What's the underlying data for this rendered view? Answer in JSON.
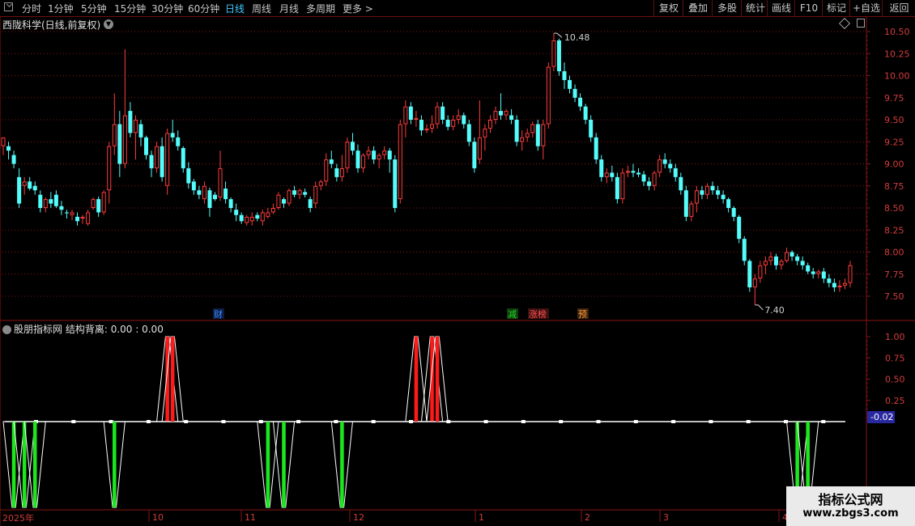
{
  "toolbar": {
    "periods": [
      "分时",
      "1分钟",
      "5分钟",
      "15分钟",
      "30分钟",
      "60分钟",
      "日线",
      "周线",
      "月线",
      "多周期",
      "更多 >"
    ],
    "active_period": "日线",
    "right_buttons": [
      "复权",
      "叠加",
      "多股",
      "统计",
      "画线",
      "F10",
      "标记",
      "+自选",
      "返回"
    ]
  },
  "main_chart": {
    "title": "西陇科学(日线,前复权)",
    "y_ticks": [
      "10.50",
      "10.25",
      "10.00",
      "9.75",
      "9.50",
      "9.25",
      "9.00",
      "8.75",
      "8.50",
      "8.25",
      "8.00",
      "7.75",
      "7.50"
    ],
    "high_label": "10.48",
    "low_label": "7.40",
    "event_markers": [
      {
        "text": "财",
        "color": "#3c8cff"
      },
      {
        "text": "减",
        "color": "#22d622"
      },
      {
        "text": "涨榜",
        "color": "#ff5050"
      },
      {
        "text": "预",
        "color": "#ff9a30"
      }
    ],
    "colors": {
      "up": "#ff3c3c",
      "down": "#54fcfc",
      "grid": "#8a1414"
    }
  },
  "indicator": {
    "site": "股朋指标网",
    "name": "结构背离",
    "values": "0.00 : 0.00",
    "y_ticks": [
      "1.00",
      "0.75",
      "0.50",
      "0.25"
    ],
    "current_value": "-0.02",
    "colors": {
      "positive": "#ff1a1a",
      "negative": "#1ee61e",
      "baseline": "#ffffff"
    }
  },
  "time_axis": {
    "year_label": "2025年",
    "labels": [
      "10",
      "11",
      "12",
      "1",
      "2",
      "3",
      "4"
    ]
  },
  "watermark": {
    "line1": "指标公式网",
    "line2": "www.zbgs3.com"
  },
  "chart_data": {
    "type": "candlestick",
    "title": "西陇科学(日线,前复权)",
    "ylim": [
      7.35,
      10.6
    ],
    "candles": [
      [
        9.2,
        9.3,
        9.1,
        9.3
      ],
      [
        9.2,
        9.25,
        9.05,
        9.15
      ],
      [
        9.1,
        9.15,
        8.95,
        9.0
      ],
      [
        8.85,
        8.95,
        8.5,
        8.55
      ],
      [
        8.75,
        8.85,
        8.65,
        8.8
      ],
      [
        8.8,
        8.85,
        8.7,
        8.72
      ],
      [
        8.75,
        8.8,
        8.65,
        8.7
      ],
      [
        8.65,
        8.7,
        8.45,
        8.5
      ],
      [
        8.5,
        8.62,
        8.45,
        8.6
      ],
      [
        8.6,
        8.68,
        8.5,
        8.55
      ],
      [
        8.65,
        8.7,
        8.5,
        8.52
      ],
      [
        8.52,
        8.58,
        8.42,
        8.48
      ],
      [
        8.45,
        8.48,
        8.38,
        8.44
      ],
      [
        8.42,
        8.48,
        8.36,
        8.45
      ],
      [
        8.4,
        8.45,
        8.3,
        8.35
      ],
      [
        8.38,
        8.42,
        8.32,
        8.4
      ],
      [
        8.32,
        8.48,
        8.3,
        8.45
      ],
      [
        8.5,
        8.62,
        8.48,
        8.6
      ],
      [
        8.6,
        8.63,
        8.4,
        8.45
      ],
      [
        8.45,
        8.7,
        8.42,
        8.68
      ],
      [
        8.7,
        9.25,
        8.55,
        9.2
      ],
      [
        9.2,
        9.8,
        9.1,
        9.45
      ],
      [
        9.45,
        9.6,
        8.85,
        9.0
      ],
      [
        9.0,
        10.3,
        8.95,
        9.55
      ],
      [
        9.6,
        9.7,
        9.3,
        9.35
      ],
      [
        9.35,
        9.55,
        9.05,
        9.5
      ],
      [
        9.45,
        9.5,
        9.2,
        9.3
      ],
      [
        9.3,
        9.32,
        9.05,
        9.1
      ],
      [
        9.1,
        9.15,
        8.85,
        8.95
      ],
      [
        8.95,
        9.25,
        8.9,
        9.2
      ],
      [
        9.2,
        9.3,
        8.8,
        8.85
      ],
      [
        8.75,
        9.4,
        8.65,
        9.35
      ],
      [
        9.35,
        9.5,
        9.25,
        9.3
      ],
      [
        9.3,
        9.38,
        9.15,
        9.2
      ],
      [
        9.18,
        9.2,
        8.9,
        8.95
      ],
      [
        8.95,
        9.02,
        8.72,
        8.78
      ],
      [
        8.8,
        8.83,
        8.65,
        8.7
      ],
      [
        8.7,
        8.75,
        8.6,
        8.65
      ],
      [
        8.6,
        8.8,
        8.55,
        8.75
      ],
      [
        8.7,
        8.73,
        8.4,
        8.5
      ],
      [
        8.65,
        8.68,
        8.58,
        8.6
      ],
      [
        8.62,
        9.15,
        8.58,
        8.95
      ],
      [
        8.72,
        8.8,
        8.55,
        8.6
      ],
      [
        8.6,
        8.62,
        8.45,
        8.5
      ],
      [
        8.48,
        8.55,
        8.35,
        8.42
      ],
      [
        8.42,
        8.45,
        8.32,
        8.35
      ],
      [
        8.33,
        8.42,
        8.3,
        8.4
      ],
      [
        8.35,
        8.45,
        8.3,
        8.4
      ],
      [
        8.42,
        8.45,
        8.35,
        8.38
      ],
      [
        8.35,
        8.48,
        8.3,
        8.45
      ],
      [
        8.4,
        8.5,
        8.38,
        8.45
      ],
      [
        8.45,
        8.55,
        8.43,
        8.5
      ],
      [
        8.5,
        8.68,
        8.48,
        8.65
      ],
      [
        8.6,
        8.62,
        8.5,
        8.55
      ],
      [
        8.55,
        8.72,
        8.52,
        8.7
      ],
      [
        8.7,
        8.75,
        8.62,
        8.65
      ],
      [
        8.65,
        8.72,
        8.6,
        8.7
      ],
      [
        8.68,
        8.72,
        8.62,
        8.65
      ],
      [
        8.6,
        8.63,
        8.45,
        8.5
      ],
      [
        8.55,
        8.8,
        8.5,
        8.75
      ],
      [
        8.75,
        8.82,
        8.7,
        8.8
      ],
      [
        8.8,
        9.12,
        8.75,
        9.05
      ],
      [
        9.05,
        9.15,
        8.95,
        9.0
      ],
      [
        8.95,
        9.0,
        8.8,
        8.85
      ],
      [
        8.85,
        9.1,
        8.8,
        8.95
      ],
      [
        8.95,
        9.3,
        8.9,
        9.25
      ],
      [
        9.25,
        9.35,
        9.1,
        9.15
      ],
      [
        9.15,
        9.22,
        8.9,
        8.95
      ],
      [
        8.95,
        9.12,
        8.9,
        9.1
      ],
      [
        9.1,
        9.2,
        9.05,
        9.15
      ],
      [
        9.15,
        9.2,
        9.0,
        9.05
      ],
      [
        9.05,
        9.12,
        8.95,
        9.1
      ],
      [
        9.1,
        9.2,
        9.05,
        9.15
      ],
      [
        9.15,
        9.18,
        8.9,
        9.05
      ],
      [
        9.05,
        9.1,
        8.45,
        8.5
      ],
      [
        8.6,
        9.5,
        8.55,
        9.45
      ],
      [
        9.45,
        9.72,
        9.3,
        9.65
      ],
      [
        9.65,
        9.7,
        9.45,
        9.5
      ],
      [
        9.5,
        9.6,
        9.42,
        9.52
      ],
      [
        9.5,
        9.55,
        9.32,
        9.38
      ],
      [
        9.38,
        9.45,
        9.35,
        9.4
      ],
      [
        9.4,
        9.55,
        9.35,
        9.45
      ],
      [
        9.45,
        9.7,
        9.4,
        9.65
      ],
      [
        9.65,
        9.7,
        9.45,
        9.5
      ],
      [
        9.5,
        9.55,
        9.38,
        9.42
      ],
      [
        9.42,
        9.55,
        9.38,
        9.5
      ],
      [
        9.5,
        9.62,
        9.45,
        9.55
      ],
      [
        9.55,
        9.58,
        9.4,
        9.45
      ],
      [
        9.45,
        9.5,
        9.2,
        9.25
      ],
      [
        9.25,
        9.3,
        8.9,
        8.95
      ],
      [
        9.05,
        9.72,
        9.0,
        9.3
      ],
      [
        9.3,
        9.45,
        9.15,
        9.4
      ],
      [
        9.4,
        9.55,
        9.35,
        9.5
      ],
      [
        9.5,
        9.65,
        9.45,
        9.6
      ],
      [
        9.6,
        9.8,
        9.5,
        9.55
      ],
      [
        9.55,
        9.62,
        9.5,
        9.6
      ],
      [
        9.55,
        9.62,
        9.45,
        9.5
      ],
      [
        9.5,
        9.55,
        9.2,
        9.25
      ],
      [
        9.25,
        9.38,
        9.15,
        9.3
      ],
      [
        9.3,
        9.4,
        9.25,
        9.35
      ],
      [
        9.35,
        9.48,
        9.3,
        9.45
      ],
      [
        9.45,
        9.5,
        9.15,
        9.2
      ],
      [
        9.2,
        9.5,
        9.05,
        9.45
      ],
      [
        9.45,
        10.15,
        9.4,
        10.1
      ],
      [
        10.1,
        10.48,
        10.05,
        10.4
      ],
      [
        10.4,
        10.42,
        10.0,
        10.05
      ],
      [
        10.05,
        10.15,
        9.85,
        9.95
      ],
      [
        9.95,
        10.0,
        9.8,
        9.85
      ],
      [
        9.85,
        9.9,
        9.7,
        9.75
      ],
      [
        9.75,
        9.8,
        9.6,
        9.65
      ],
      [
        9.65,
        9.68,
        9.45,
        9.5
      ],
      [
        9.5,
        9.55,
        9.25,
        9.3
      ],
      [
        9.3,
        9.35,
        9.0,
        9.05
      ],
      [
        9.05,
        9.1,
        8.8,
        8.85
      ],
      [
        8.85,
        8.95,
        8.78,
        8.9
      ],
      [
        8.9,
        8.98,
        8.8,
        8.85
      ],
      [
        8.85,
        8.9,
        8.55,
        8.6
      ],
      [
        8.6,
        8.95,
        8.55,
        8.9
      ],
      [
        8.9,
        8.98,
        8.85,
        8.92
      ],
      [
        8.92,
        9.0,
        8.85,
        8.9
      ],
      [
        8.9,
        8.95,
        8.85,
        8.88
      ],
      [
        8.88,
        8.92,
        8.75,
        8.8
      ],
      [
        8.8,
        8.85,
        8.7,
        8.75
      ],
      [
        8.75,
        8.92,
        8.7,
        8.9
      ],
      [
        8.9,
        9.1,
        8.85,
        9.05
      ],
      [
        9.05,
        9.12,
        8.95,
        9.0
      ],
      [
        9.0,
        9.05,
        8.9,
        8.95
      ],
      [
        8.95,
        9.0,
        8.8,
        8.85
      ],
      [
        8.85,
        8.9,
        8.65,
        8.7
      ],
      [
        8.7,
        8.75,
        8.35,
        8.4
      ],
      [
        8.4,
        8.58,
        8.35,
        8.55
      ],
      [
        8.55,
        8.75,
        8.45,
        8.7
      ],
      [
        8.7,
        8.75,
        8.6,
        8.65
      ],
      [
        8.65,
        8.78,
        8.6,
        8.75
      ],
      [
        8.75,
        8.8,
        8.65,
        8.7
      ],
      [
        8.7,
        8.75,
        8.6,
        8.65
      ],
      [
        8.65,
        8.7,
        8.55,
        8.6
      ],
      [
        8.6,
        8.62,
        8.45,
        8.5
      ],
      [
        8.5,
        8.52,
        8.35,
        8.4
      ],
      [
        8.4,
        8.42,
        8.1,
        8.15
      ],
      [
        8.15,
        8.18,
        7.85,
        7.9
      ],
      [
        7.9,
        7.92,
        7.55,
        7.6
      ],
      [
        7.6,
        7.75,
        7.4,
        7.7
      ],
      [
        7.7,
        7.9,
        7.65,
        7.85
      ],
      [
        7.85,
        7.95,
        7.75,
        7.9
      ],
      [
        7.9,
        8.0,
        7.85,
        7.95
      ],
      [
        7.95,
        7.98,
        7.8,
        7.85
      ],
      [
        7.85,
        7.92,
        7.8,
        7.9
      ],
      [
        7.9,
        8.05,
        7.88,
        8.0
      ],
      [
        8.0,
        8.02,
        7.9,
        7.95
      ],
      [
        7.95,
        7.98,
        7.85,
        7.9
      ],
      [
        7.9,
        7.95,
        7.8,
        7.85
      ],
      [
        7.85,
        7.88,
        7.75,
        7.78
      ],
      [
        7.78,
        7.82,
        7.7,
        7.75
      ],
      [
        7.75,
        7.8,
        7.7,
        7.78
      ],
      [
        7.78,
        7.82,
        7.65,
        7.7
      ],
      [
        7.7,
        7.75,
        7.6,
        7.65
      ],
      [
        7.65,
        7.7,
        7.55,
        7.6
      ],
      [
        7.6,
        7.68,
        7.55,
        7.62
      ],
      [
        7.62,
        7.7,
        7.58,
        7.65
      ],
      [
        7.65,
        7.9,
        7.6,
        7.85
      ]
    ],
    "indicator_series": {
      "name": "结构背离",
      "red_pulses": [
        {
          "day": 31,
          "value": 1.0
        },
        {
          "day": 32,
          "value": 1.0
        },
        {
          "day": 78,
          "value": 1.0
        },
        {
          "day": 81,
          "value": 1.0
        },
        {
          "day": 82,
          "value": 1.0
        }
      ],
      "green_pulses": [
        {
          "day": 2,
          "value": -1.0
        },
        {
          "day": 4,
          "value": -1.0
        },
        {
          "day": 6,
          "value": -1.0
        },
        {
          "day": 21,
          "value": -1.0
        },
        {
          "day": 50,
          "value": -1.0
        },
        {
          "day": 53,
          "value": -1.0
        },
        {
          "day": 64,
          "value": -1.0
        },
        {
          "day": 150,
          "value": -1.0
        },
        {
          "day": 152,
          "value": -1.0
        },
        {
          "day": 197,
          "value": -1.0
        },
        {
          "day": 220,
          "value": -1.0
        },
        {
          "day": 222,
          "value": -1.0
        }
      ]
    }
  }
}
